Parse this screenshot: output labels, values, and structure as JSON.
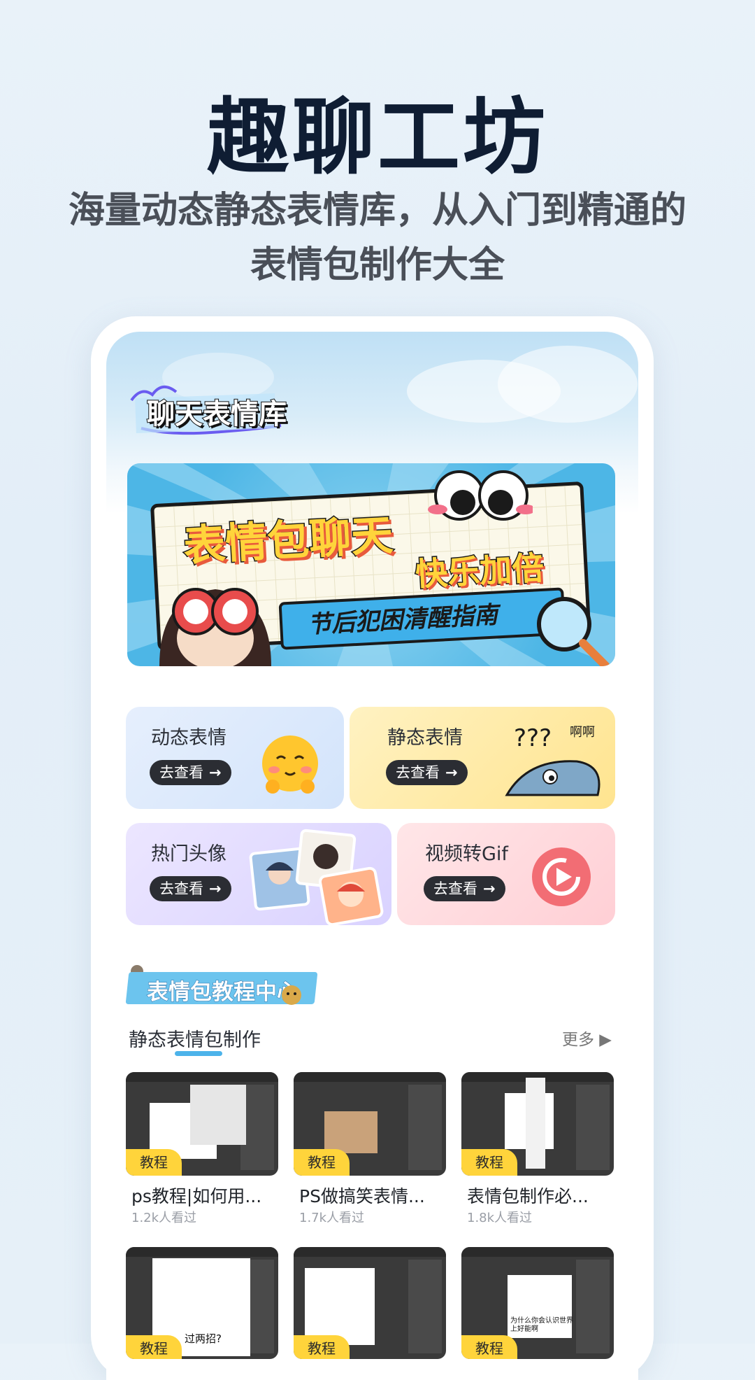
{
  "hero": {
    "title": "趣聊工坊",
    "subtitle_line1": "海量动态静态表情库，从入门到精通的",
    "subtitle_line2": "表情包制作大全"
  },
  "library": {
    "title": "聊天表情库",
    "banner": {
      "line1": "表情包聊天",
      "line2": "快乐加倍",
      "line3": "节后犯困清醒指南"
    }
  },
  "features": [
    {
      "title": "动态表情",
      "button": "去查看",
      "icon": "smiling-emoji-icon"
    },
    {
      "title": "静态表情",
      "button": "去查看",
      "icon": "confused-fish-icon",
      "sticker_text": "???",
      "sticker_text2": "啊啊"
    },
    {
      "title": "热门头像",
      "button": "去查看",
      "icon": "avatar-collage-icon"
    },
    {
      "title": "视频转Gif",
      "button": "去查看",
      "icon": "play-circle-icon"
    }
  ],
  "tutorials": {
    "header": "表情包教程中心",
    "tab": "静态表情包制作",
    "more": "更多",
    "tag_label": "教程",
    "items": [
      {
        "title": "ps教程|如何用...",
        "views": "1.2k人看过"
      },
      {
        "title": "PS做搞笑表情...",
        "views": "1.7k人看过"
      },
      {
        "title": "表情包制作必...",
        "views": "1.8k人看过"
      },
      {
        "title": "",
        "views": "",
        "caption": "过两招?"
      },
      {
        "title": "",
        "views": ""
      },
      {
        "title": "",
        "views": "",
        "caption": "为什么你会认识世界上好能啊"
      }
    ]
  },
  "colors": {
    "accent_blue": "#4cb3ea",
    "tag_yellow": "#ffd43b",
    "card_blue": "#dceaff",
    "card_yellow": "#ffe79a",
    "card_purple": "#e2dcff",
    "card_pink": "#ffd9dd"
  }
}
